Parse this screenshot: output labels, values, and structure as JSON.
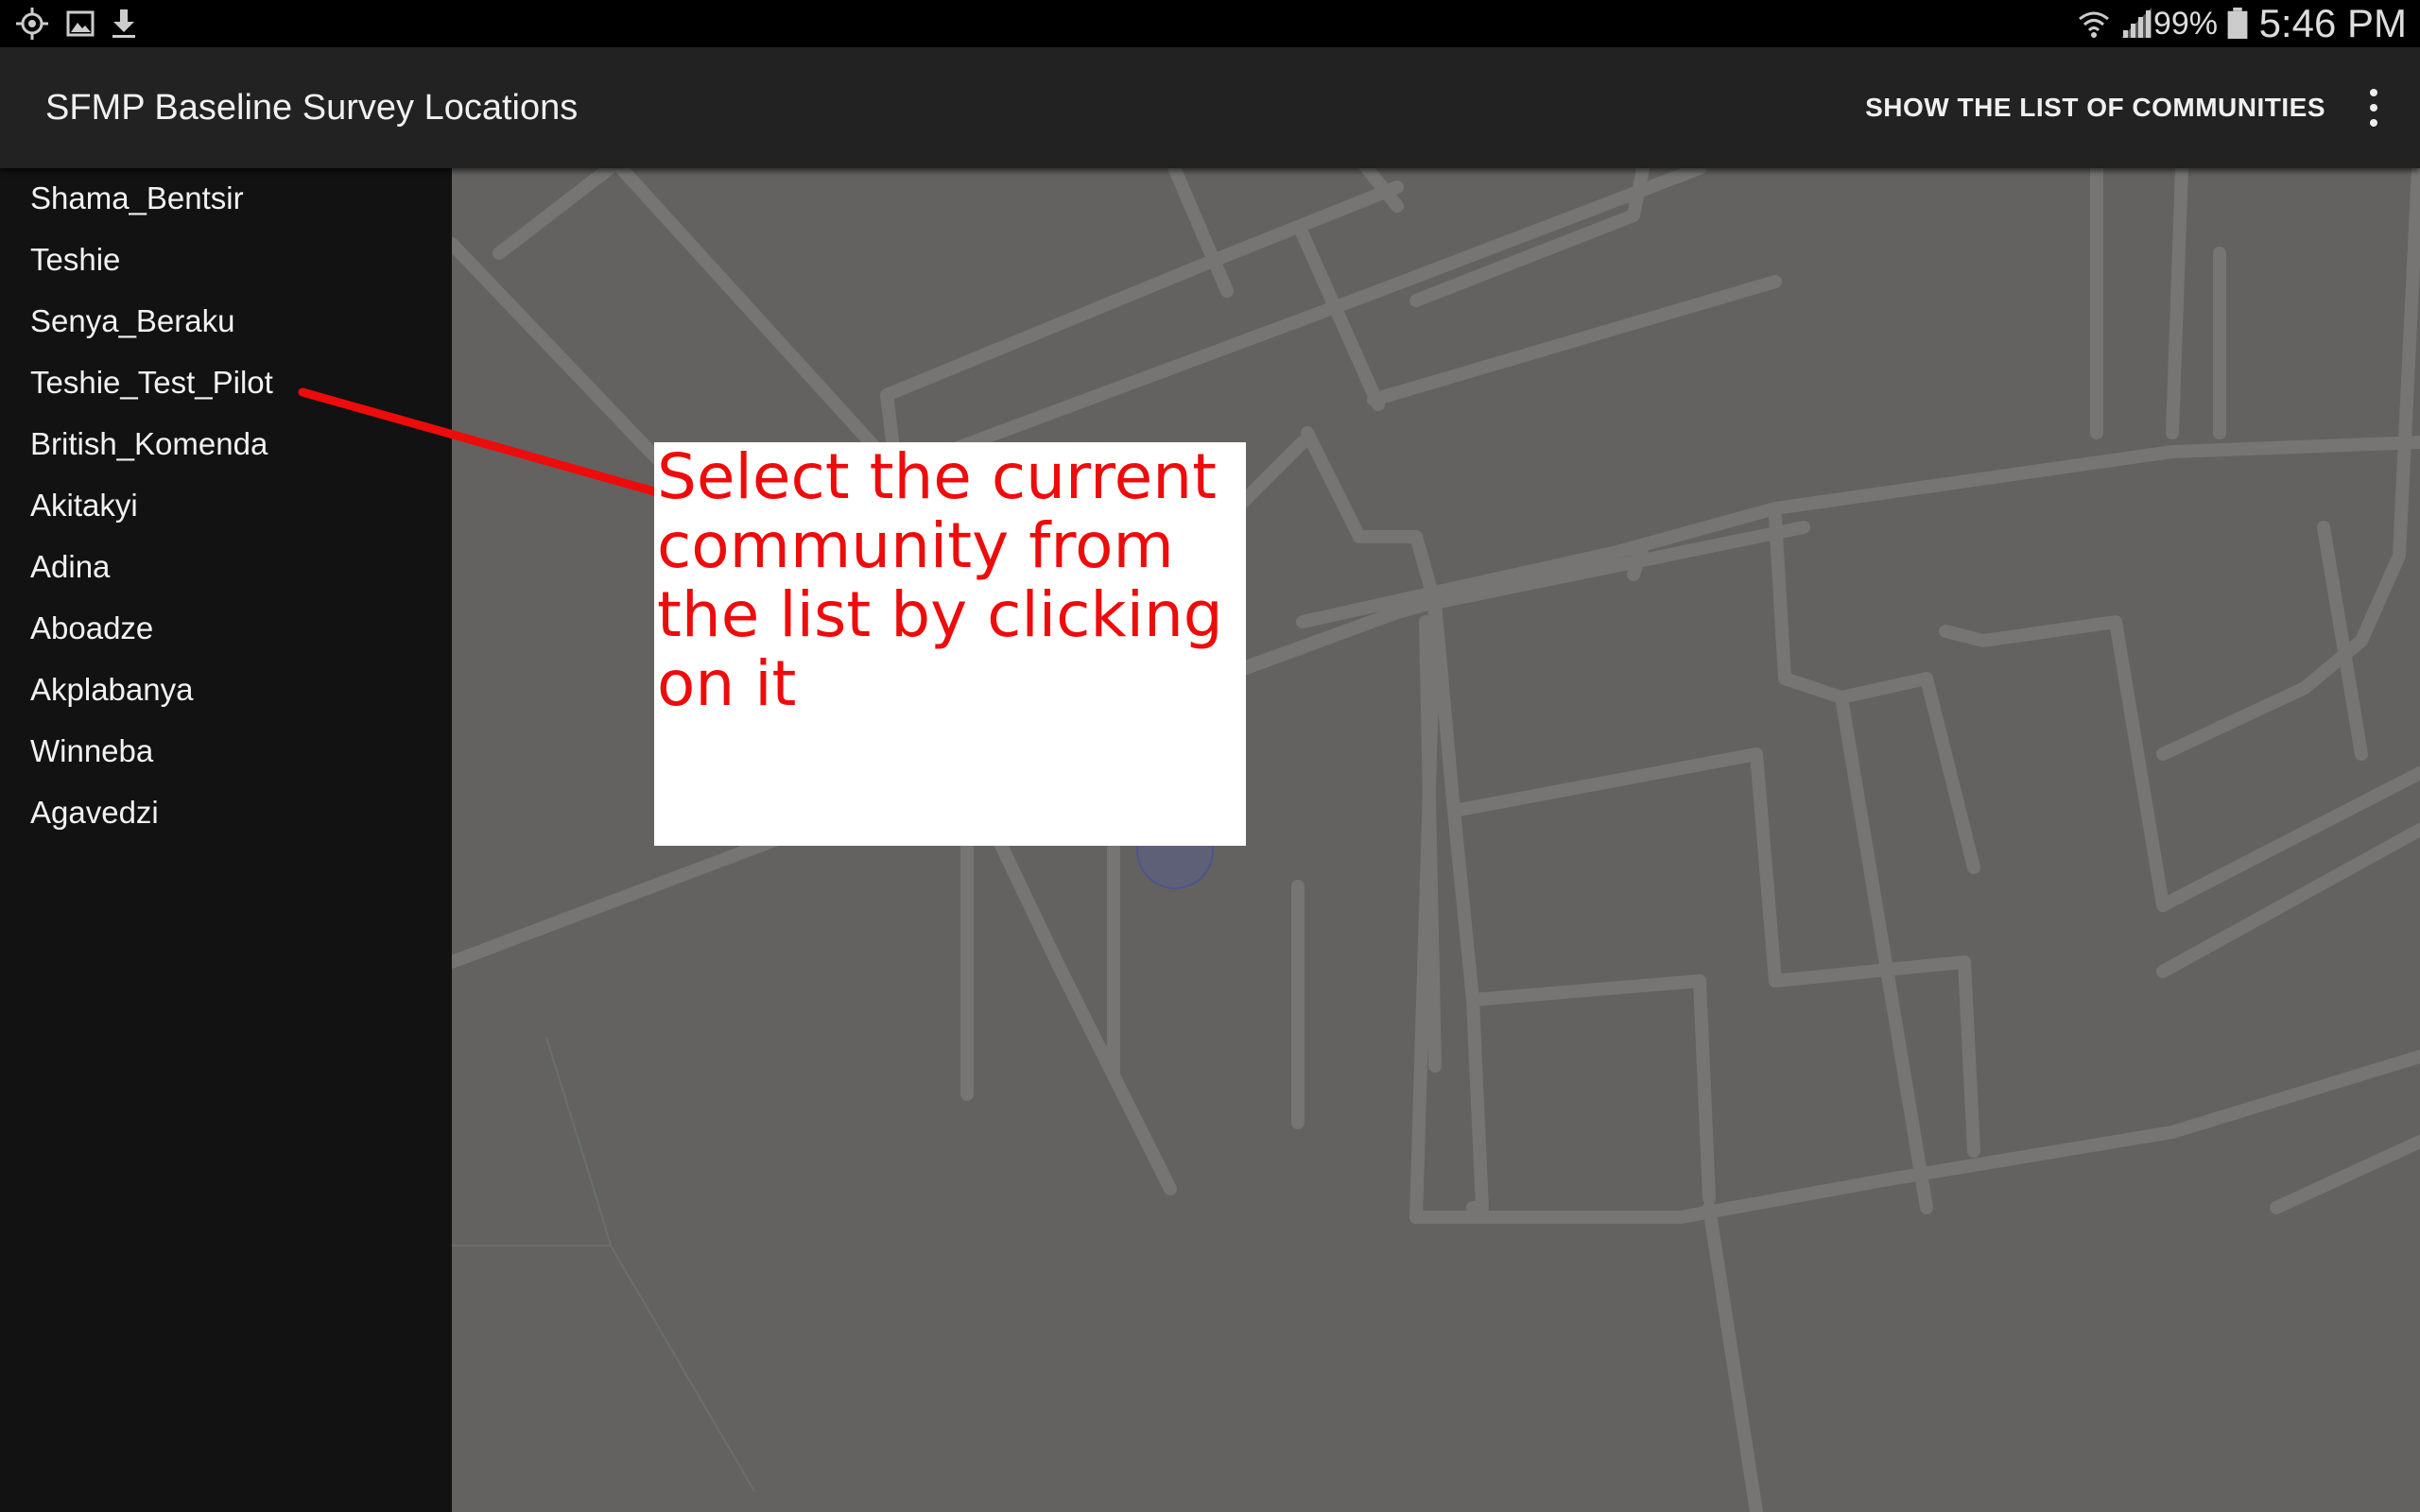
{
  "status_bar": {
    "icons_left": [
      "location-icon",
      "image-icon",
      "download-icon"
    ],
    "icons_right": [
      "wifi-icon",
      "signal-icon",
      "battery-icon"
    ],
    "battery_percent": "99%",
    "time": "5:46 PM"
  },
  "action_bar": {
    "title": "SFMP Baseline Survey Locations",
    "show_list_label": "SHOW THE LIST OF COMMUNITIES",
    "overflow_icon": "more-vertical-icon"
  },
  "communities": [
    "Shama_Bentsir",
    "Teshie",
    "Senya_Beraku",
    "Teshie_Test_Pilot",
    "British_Komenda",
    "Akitakyi",
    "Adina",
    "Aboadze",
    "Akplabanya",
    "Winneba",
    "Agavedzi"
  ],
  "tip": {
    "text": "Select the current community from the list by clicking on it"
  },
  "colors": {
    "status_bar": "#000000",
    "action_bar": "#222222",
    "sidebar": "#121212",
    "map_background": "#636260",
    "map_roads": "#767573",
    "tip_text": "#ee0b0b",
    "pointer": "#ee0b0b"
  }
}
